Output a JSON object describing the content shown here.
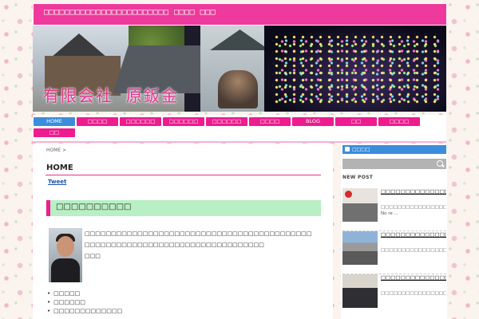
{
  "header": {
    "site_title": "□□□□□□□□□□□□□□□□□□□□□□□□ □□□□ □□□",
    "subtitle": "□□□□□□□□□□□□□□□□□□□□□□□□□□□□□",
    "brand_part1": "有限会社",
    "brand_part2": "原鈑金"
  },
  "nav": {
    "items": [
      {
        "label": "HOME",
        "active": true
      },
      {
        "label": "□□□□"
      },
      {
        "label": "□□□□□□"
      },
      {
        "label": "□□□□□□"
      },
      {
        "label": "□□□□□□"
      },
      {
        "label": "□□□□"
      },
      {
        "label": "BLOG"
      },
      {
        "label": "□□"
      },
      {
        "label": "□□□□"
      },
      {
        "label": "□□"
      }
    ]
  },
  "main": {
    "breadcrumb": "HOME",
    "breadcrumb_sep": ">",
    "page_heading": "HOME",
    "tweet_label": "Tweet",
    "greeting_heading": "□□□□□□□□□□",
    "intro_lines": [
      "□□□□□□□□□□□□□□□□□□□□□□□□□□□□□□□□□□□□□□□□□□□",
      "□□□□□□□□□□□□□□□□□□□□□□□□□□□□□□□□□□",
      "□□□"
    ],
    "bullets": [
      "□□□□□",
      "□□□□□□",
      "□□□□□□□□□□□□□"
    ]
  },
  "sidebar": {
    "rss_label": "□□□□",
    "section_title": "NEW POST",
    "posts": [
      {
        "title": "□□□□□□□□□□□□□□□□□□□□□□□",
        "excerpt": "□□□□□□□□□□□□□□□□□□□□□□□□□□□□□□□□□□ No re ..."
      },
      {
        "title": "□□□□□□□□□□□□□□□□□□□□□□",
        "excerpt": "□□□□□□□□□□□□□□□□□□□□□□□□□□□□□□□□□□□□□□□□"
      },
      {
        "title": "□□□□□□□□□□□□□□□□□□□□□□□□□□",
        "excerpt": "□□□□□□□□□□□□□□□□□□□□□□□□□□□□□□□□□□□□□□□□"
      }
    ]
  },
  "colors": {
    "accent_pink": "#ee1c8e",
    "nav_active_blue": "#3b8ddb",
    "greeting_green": "#b8efc4"
  }
}
